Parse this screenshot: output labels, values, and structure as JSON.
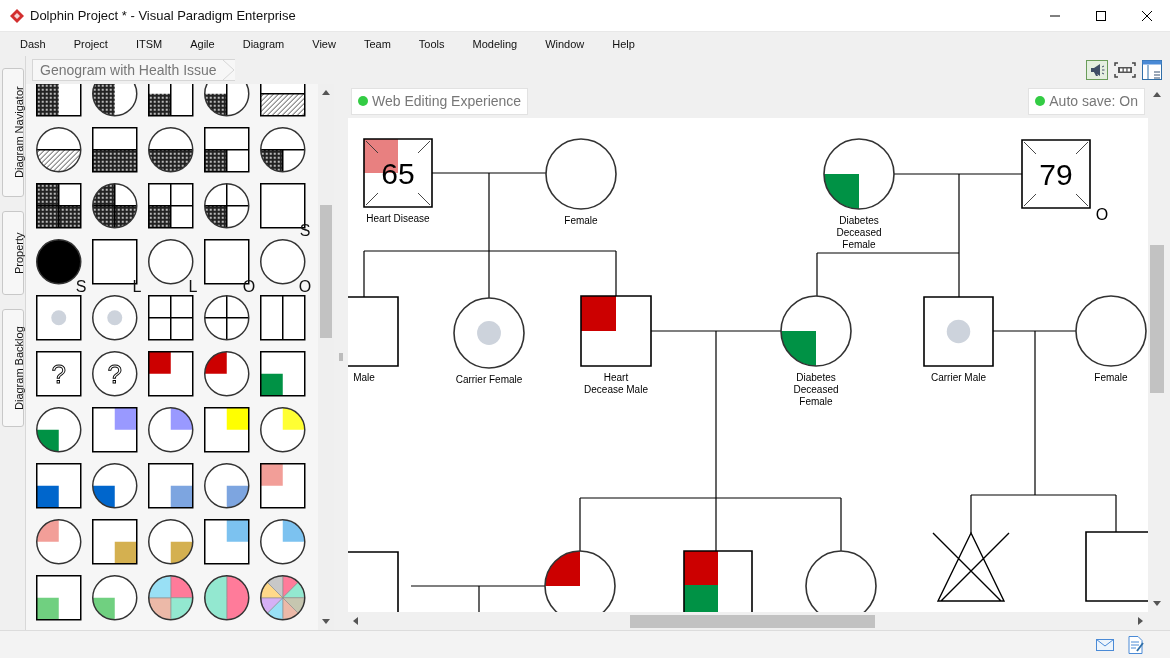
{
  "window": {
    "title": "Dolphin Project * - Visual Paradigm Enterprise"
  },
  "menu": [
    "Dash",
    "Project",
    "ITSM",
    "Agile",
    "Diagram",
    "View",
    "Team",
    "Tools",
    "Modeling",
    "Window",
    "Help"
  ],
  "side_tabs": [
    {
      "label": "Diagram Navigator"
    },
    {
      "label": "Property"
    },
    {
      "label": "Diagram Backlog"
    }
  ],
  "breadcrumb": "Genogram with Health Issue",
  "palette_labels": [
    "S",
    "S",
    "L",
    "L",
    "O",
    "O",
    "?",
    "?"
  ],
  "badges": [
    {
      "label": "Web Editing Experience",
      "color": "#33cc44"
    },
    {
      "label": "Auto save: On",
      "color": "#33cc44"
    }
  ],
  "genogram": {
    "nodes": [
      {
        "kind": "male",
        "label": "Heart Disease",
        "age": "65",
        "deceased": true,
        "carrier": false,
        "fills": [
          {
            "kind": "topleft",
            "color": "#e88080"
          }
        ]
      },
      {
        "kind": "female",
        "label": "Female",
        "deceased": false,
        "carrier": false
      },
      {
        "kind": "female",
        "label": "Diabetes\nDeceased\nFemale",
        "deceased": false,
        "carrier": false,
        "fills": [
          {
            "kind": "bottomleft",
            "color": "#009245"
          }
        ]
      },
      {
        "kind": "male",
        "age": "79",
        "deceased": true,
        "carrier": false,
        "suffix": "O"
      },
      {
        "kind": "male",
        "label": "Male",
        "deceased": false,
        "carrier": false
      },
      {
        "kind": "female",
        "label": "Carrier Female",
        "deceased": false,
        "carrier": true
      },
      {
        "kind": "male",
        "label": "Heart\nDecease Male",
        "deceased": false,
        "carrier": false,
        "fills": [
          {
            "kind": "topleft",
            "color": "#cc0000"
          }
        ]
      },
      {
        "kind": "female",
        "label": "Diabetes\nDeceased\nFemale",
        "deceased": false,
        "carrier": false,
        "fills": [
          {
            "kind": "bottomleft",
            "color": "#009245"
          }
        ]
      },
      {
        "kind": "male",
        "label": "Carrier Male",
        "deceased": false,
        "carrier": true
      },
      {
        "kind": "female",
        "label": "Female",
        "deceased": false,
        "carrier": false
      },
      {
        "kind": "male",
        "deceased": false,
        "carrier": false
      },
      {
        "kind": "female",
        "deceased": false,
        "carrier": false,
        "fills": [
          {
            "kind": "topleft",
            "color": "#cc0000"
          }
        ]
      },
      {
        "kind": "male",
        "deceased": false,
        "carrier": false,
        "fills": [
          {
            "kind": "topleft",
            "color": "#cc0000"
          },
          {
            "kind": "bottomleft",
            "color": "#009245"
          }
        ]
      },
      {
        "kind": "female",
        "deceased": false,
        "carrier": false
      },
      {
        "kind": "loss",
        "deceased": false,
        "carrier": false
      },
      {
        "kind": "male",
        "deceased": false,
        "carrier": false
      }
    ]
  }
}
